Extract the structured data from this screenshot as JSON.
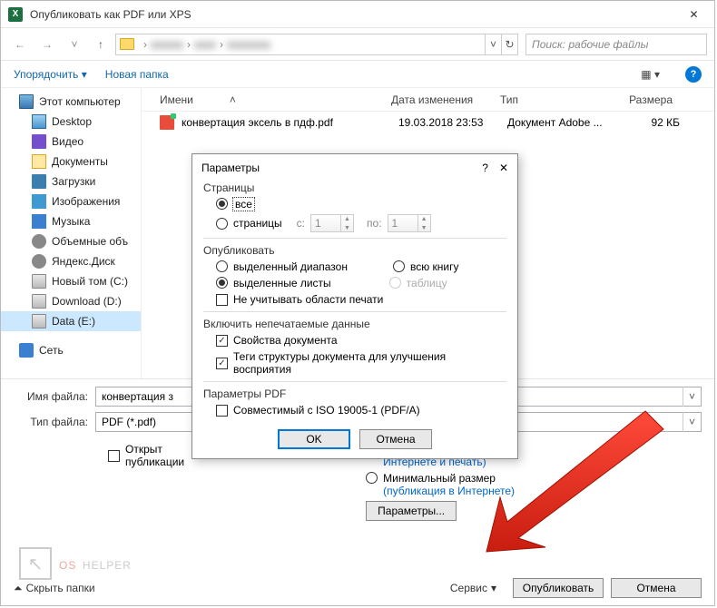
{
  "window": {
    "title": "Опубликовать как PDF или XPS"
  },
  "nav": {
    "search_placeholder": "Поиск: рабочие файлы"
  },
  "toolbar": {
    "organize": "Упорядочить",
    "new_folder": "Новая папка"
  },
  "sidebar": {
    "items": [
      {
        "label": "Этот компьютер",
        "icon": "icon-pc"
      },
      {
        "label": "Desktop",
        "icon": "icon-desktop"
      },
      {
        "label": "Видео",
        "icon": "icon-video"
      },
      {
        "label": "Документы",
        "icon": "icon-docs"
      },
      {
        "label": "Загрузки",
        "icon": "icon-downloads"
      },
      {
        "label": "Изображения",
        "icon": "icon-images"
      },
      {
        "label": "Музыка",
        "icon": "icon-music"
      },
      {
        "label": "Объемные объ",
        "icon": "icon-volumes"
      },
      {
        "label": "Яндекс.Диск",
        "icon": "icon-yandex"
      },
      {
        "label": "Новый том (C:)",
        "icon": "icon-drive"
      },
      {
        "label": "Download (D:)",
        "icon": "icon-drive"
      },
      {
        "label": "Data (E:)",
        "icon": "icon-drive"
      },
      {
        "label": "Сеть",
        "icon": "icon-net"
      }
    ]
  },
  "headers": {
    "name": "Имени",
    "date": "Дата изменения",
    "type": "Тип",
    "size": "Размера"
  },
  "file": {
    "name": "конвертация эксель в пдф.pdf",
    "date": "19.03.2018 23:53",
    "type": "Документ Adobe ...",
    "size": "92 КБ"
  },
  "filename": {
    "label": "Имя файла:",
    "value": "конвертация з"
  },
  "filetype": {
    "label": "Тип файла:",
    "value": "PDF (*.pdf)"
  },
  "options": {
    "open_after": "Открыт\nпубликации",
    "optimize_label": "(публикация в Интернете и печать)",
    "minimal": "Минимальный размер (публикация в Интернете)",
    "params_btn": "Параметры..."
  },
  "footer": {
    "hide_folders": "Скрыть папки",
    "service": "Сервис",
    "publish": "Опубликовать",
    "cancel": "Отмена"
  },
  "modal": {
    "title": "Параметры",
    "pages": {
      "header": "Страницы",
      "all": "все",
      "range": "страницы",
      "from": "с:",
      "to": "по:",
      "from_val": "1",
      "to_val": "1"
    },
    "publish": {
      "header": "Опубликовать",
      "sel_range": "выделенный диапазон",
      "whole_book": "всю книгу",
      "sel_sheets": "выделенные листы",
      "table": "таблицу",
      "ignore_print": "Не учитывать области печати"
    },
    "nonprint": {
      "header": "Включить непечатаемые данные",
      "doc_props": "Свойства документа",
      "struct_tags": "Теги структуры документа для улучшения восприятия"
    },
    "pdf": {
      "header": "Параметры PDF",
      "iso": "Совместимый с ISO 19005-1 (PDF/A)"
    },
    "ok": "OK",
    "cancel": "Отмена"
  },
  "watermark": {
    "os": "OS",
    "helper": "HELPER"
  }
}
